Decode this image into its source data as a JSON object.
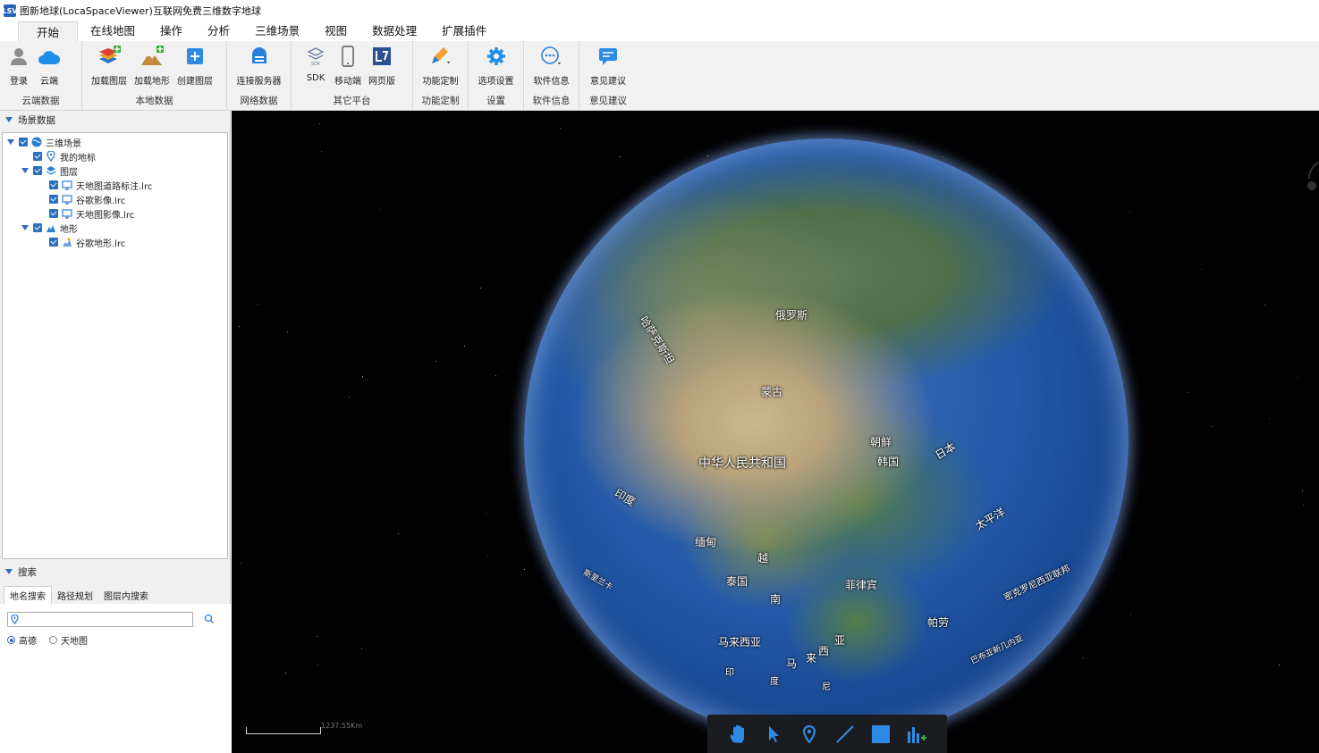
{
  "window": {
    "title": "图新地球(LocaSpaceViewer)互联网免费三维数字地球",
    "icon_text": "LSV"
  },
  "menu": [
    "开始",
    "在线地图",
    "操作",
    "分析",
    "三维场景",
    "视图",
    "数据处理",
    "扩展插件"
  ],
  "ribbon": {
    "groups": [
      {
        "label": "云端数据",
        "buttons": [
          "登录",
          "云端"
        ]
      },
      {
        "label": "本地数据",
        "buttons": [
          "加载图层",
          "加载地形",
          "创建图层"
        ]
      },
      {
        "label": "网络数据",
        "buttons": [
          "连接服务器"
        ]
      },
      {
        "label": "其它平台",
        "buttons": [
          "SDK",
          "移动端",
          "网页版"
        ]
      },
      {
        "label": "功能定制",
        "buttons": [
          "功能定制"
        ]
      },
      {
        "label": "设置",
        "buttons": [
          "选项设置"
        ]
      },
      {
        "label": "软件信息",
        "buttons": [
          "软件信息"
        ]
      },
      {
        "label": "意见建议",
        "buttons": [
          "意见建议"
        ]
      }
    ],
    "sdk_badge": "SDK"
  },
  "scene_panel": {
    "header": "场景数据",
    "tree": [
      {
        "label": "三维场景"
      },
      {
        "label": "我的地标"
      },
      {
        "label": "图层"
      },
      {
        "label": "天地图道路标注.lrc"
      },
      {
        "label": "谷歌影像.lrc"
      },
      {
        "label": "天地图影像.lrc"
      },
      {
        "label": "地形"
      },
      {
        "label": "谷歌地形.lrc"
      }
    ]
  },
  "search_panel": {
    "header": "搜索",
    "tabs": [
      "地名搜索",
      "路径规划",
      "图层内搜索"
    ],
    "input_value": "",
    "sources": [
      "高德",
      "天地图"
    ],
    "selected_source": "高德"
  },
  "globe": {
    "labels": [
      "俄罗斯",
      "哈萨克斯坦",
      "蒙古",
      "中华人民共和国",
      "朝鲜",
      "韩国",
      "日本",
      "太平洋",
      "印度",
      "缅甸",
      "越",
      "泰国",
      "南",
      "菲律宾",
      "帕劳",
      "马来西亚",
      "亚",
      "马",
      "来",
      "西",
      "印",
      "度",
      "尼",
      "斯里兰卡",
      "密克罗尼西亚联邦",
      "巴布亚新几内亚"
    ],
    "scale_text": "1237.55Km"
  },
  "colors": {
    "accent": "#2b6fbf",
    "space": "#020203",
    "ribbon_bg": "#f1f1f1"
  }
}
